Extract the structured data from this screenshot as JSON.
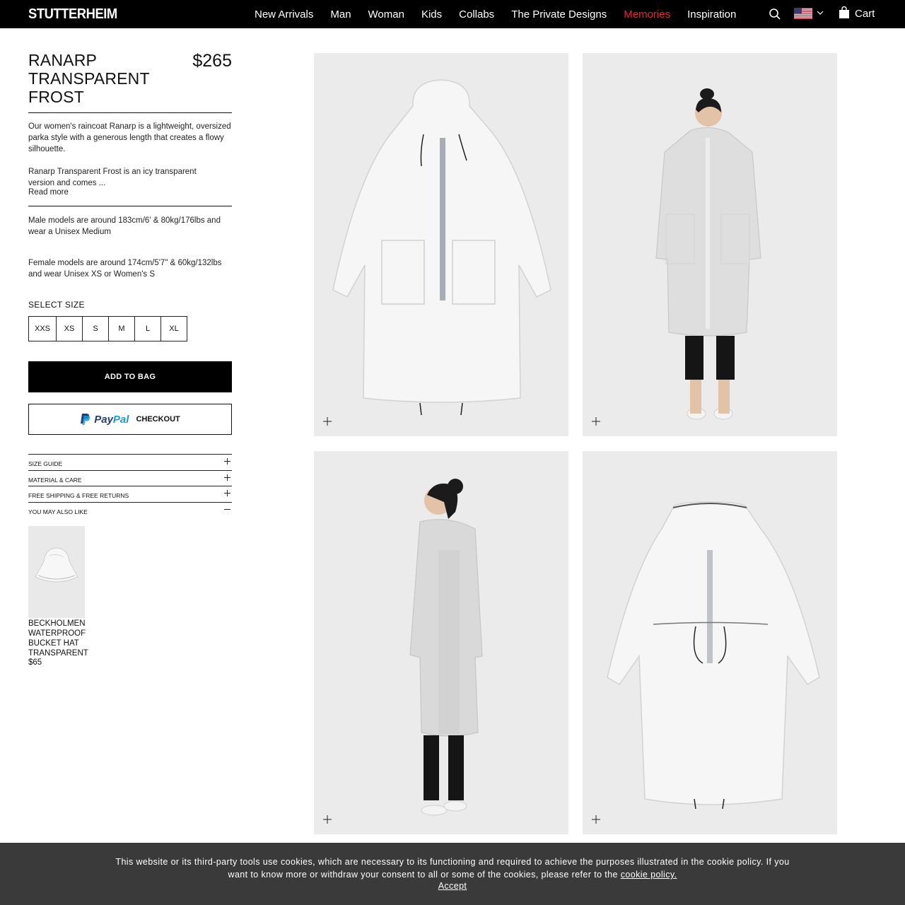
{
  "header": {
    "logo": "STUTTERHEIM",
    "nav": [
      {
        "label": "New Arrivals",
        "active": false
      },
      {
        "label": "Man",
        "active": false
      },
      {
        "label": "Woman",
        "active": false
      },
      {
        "label": "Kids",
        "active": false
      },
      {
        "label": "Collabs",
        "active": false
      },
      {
        "label": "The Private Designs",
        "active": false
      },
      {
        "label": "Memories",
        "active": true
      },
      {
        "label": "Inspiration",
        "active": false
      }
    ],
    "cart_label": "Cart",
    "active_color": "#e8263a",
    "icons": [
      "search-icon",
      "us-flag-icon",
      "chevron-down-icon",
      "shopping-bag-icon"
    ]
  },
  "product": {
    "title": "RANARP TRANSPARENT FROST",
    "price": "$265",
    "description_1": "Our women's raincoat Ranarp is a lightweight, oversized parka style with a generous length that creates a flowy silhouette.",
    "description_2": "Ranarp Transparent Frost is an icy transparent version and comes ...",
    "read_more": "Read more",
    "models_male": "Male models are around 183cm/6' & 80kg/176lbs and wear a Unisex Medium",
    "models_female": "Female models are around 174cm/5'7\" & 60kg/132lbs and wear Unisex XS or Women's S",
    "size_label": "SELECT SIZE",
    "sizes": [
      "XXS",
      "XS",
      "S",
      "M",
      "L",
      "XL"
    ],
    "add_to_bag": "ADD TO BAG",
    "paypal_brand_a": "Pay",
    "paypal_brand_b": "Pal",
    "paypal_checkout": "CHECKOUT",
    "accordion": [
      {
        "label": "SIZE GUIDE",
        "icon": "plus-icon"
      },
      {
        "label": "MATERIAL & CARE",
        "icon": "plus-icon"
      },
      {
        "label": "FREE SHIPPING & FREE RETURNS",
        "icon": "plus-icon"
      },
      {
        "label": "YOU MAY ALSO LIKE",
        "icon": "minus-icon"
      }
    ]
  },
  "recommendation": {
    "name": "BECKHOLMEN WATERPROOF BUCKET HAT TRANSPARENT",
    "price": "$65"
  },
  "gallery": [
    "front-flat",
    "front-model",
    "side-model",
    "back-flat"
  ],
  "cookie": {
    "text": "This website or its third-party tools use cookies, which are necessary to its functioning and required to achieve the purposes illustrated in the cookie policy. If you want to know more or withdraw your consent to all or some of the cookies, please refer to the",
    "link": "cookie policy.",
    "accept": "Accept"
  }
}
